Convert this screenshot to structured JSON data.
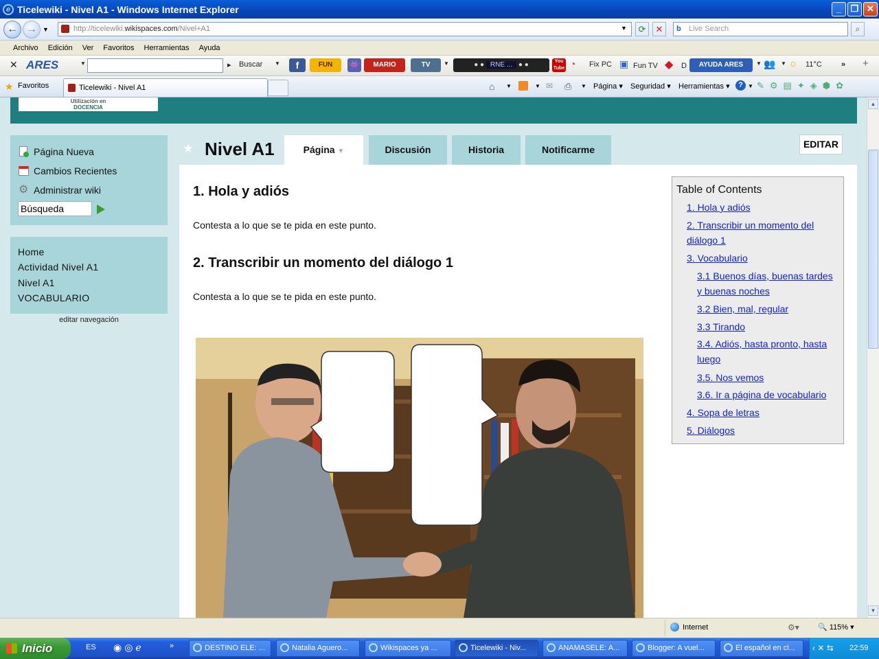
{
  "window": {
    "title": "Ticelewiki - Nivel A1 - Windows Internet Explorer"
  },
  "address": {
    "prefix": "http://ticelewiki.",
    "domain": "wikispaces.com",
    "path": "/Nivel+A1",
    "search_placeholder": "Live Search"
  },
  "menu": [
    "Archivo",
    "Edición",
    "Ver",
    "Favoritos",
    "Herramientas",
    "Ayuda"
  ],
  "toolbar": {
    "ares": "ARES",
    "buscar": "Buscar",
    "fun": "FUN",
    "mario": "MARIO",
    "tv": "TV",
    "radio": "RNE ...",
    "youtube": "You Tube",
    "fixpc": "Fix PC",
    "funtv": "Fun TV",
    "de": "D",
    "ayuda_ares": "AYUDA ARES",
    "weather": "11°C"
  },
  "tabsbar": {
    "favorites": "Favoritos",
    "tab_title": "Ticelewiki - Nivel A1",
    "pagina": "Página",
    "seguridad": "Seguridad",
    "herramientas": "Herramientas"
  },
  "site": {
    "logo_line1": "Utilización en",
    "logo_line2": "DOCENCIA",
    "side_actions": [
      "Página Nueva",
      "Cambios Recientes",
      "Administrar wiki"
    ],
    "search_value": "Búsqueda",
    "nav": [
      "Home",
      "Actividad Nivel A1",
      "Nivel A1",
      "VOCABULARIO"
    ],
    "edit_nav": "editar navegación",
    "page_title": "Nivel A1",
    "tabs": [
      "Página",
      "Discusión",
      "Historia",
      "Notificarme"
    ],
    "edit_button": "EDITAR",
    "sections": [
      {
        "heading": "1. Hola y adiós",
        "text": "Contesta a lo que se te pida en este punto."
      },
      {
        "heading": "2. Transcribir un momento del diálogo 1",
        "text": "Contesta a lo que se te pida en este punto."
      }
    ],
    "toc_title": "Table of Contents",
    "toc": [
      {
        "l1": "1. Hola y adiós",
        "l2": ""
      },
      {
        "l1": "2. Transcribir un momento del",
        "l2": "diálogo 1"
      },
      {
        "l1": "3. Vocabulario",
        "l2": ""
      },
      {
        "l1": "3.1 Buenos días, buenas tardes",
        "l2": "y buenas noches"
      },
      {
        "l1": "3.2 Bien, mal, regular",
        "l2": ""
      },
      {
        "l1": "3.3 Tirando",
        "l2": ""
      },
      {
        "l1": "3.4. Adiós, hasta pronto, hasta",
        "l2": "luego"
      },
      {
        "l1": "3.5. Nos vemos",
        "l2": ""
      },
      {
        "l1": "3.6. Ir a página de vocabulario",
        "l2": ""
      },
      {
        "l1": "4. Sopa de letras",
        "l2": ""
      },
      {
        "l1": "5. Diálogos",
        "l2": ""
      }
    ]
  },
  "status": {
    "zone": "Internet",
    "zoom": "115%"
  },
  "taskbar": {
    "start": "Inicio",
    "lang": "ES",
    "tasks": [
      "DESTINO ELE: ...",
      "Natalia Aguero...",
      "Wikispaces ya ...",
      "Ticelewiki - Niv...",
      "ANAMASELE: A...",
      "Blogger: A vuel...",
      "El español en cl..."
    ],
    "clock": "22:59"
  }
}
